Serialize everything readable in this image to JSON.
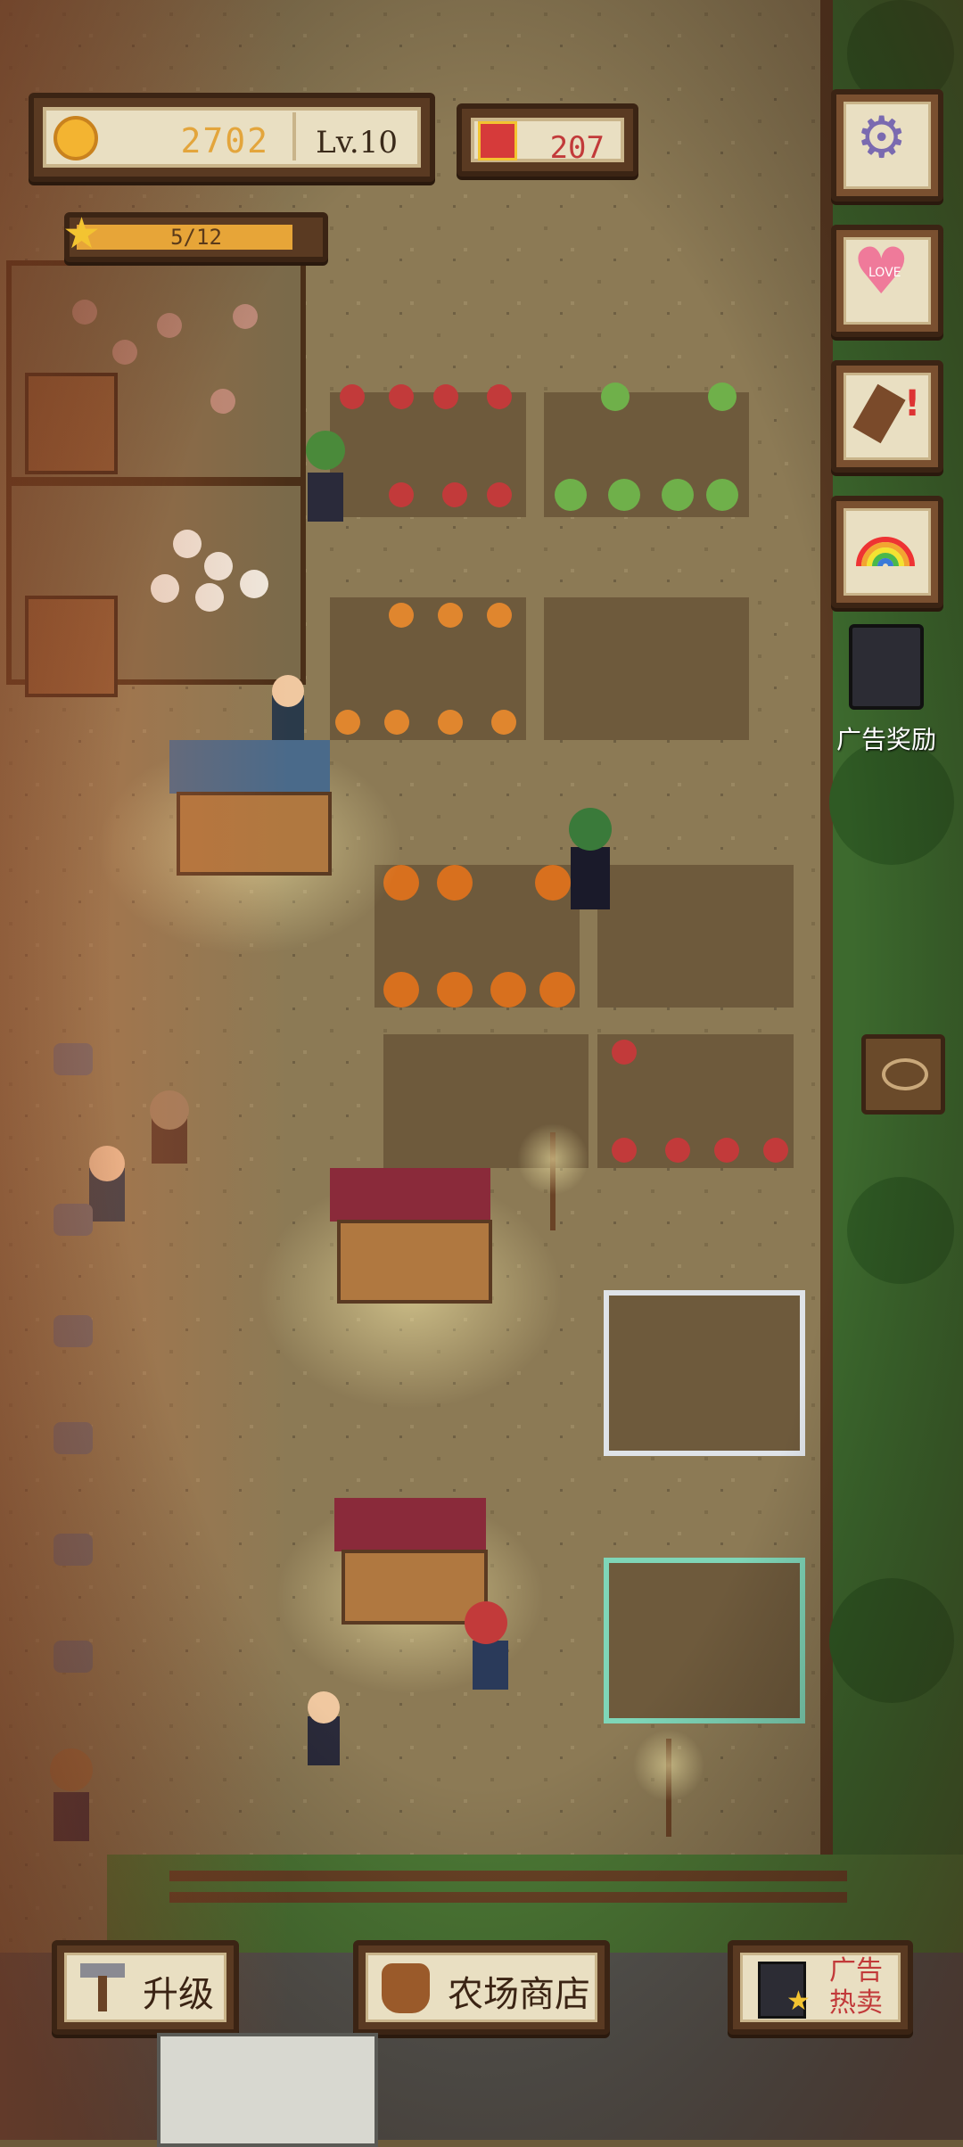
{
  "hud": {
    "coins": "2702",
    "level": "Lv.10",
    "gifts": "207",
    "xp_progress": "5/12",
    "xp_fraction": 0.4167
  },
  "side_buttons": [
    {
      "name": "settings",
      "icon": "gear-icon"
    },
    {
      "name": "love",
      "icon": "heart-icon",
      "label": "LOVE"
    },
    {
      "name": "hint",
      "icon": "shovel-icon"
    },
    {
      "name": "rainbow",
      "icon": "rainbow-icon"
    }
  ],
  "ad_reward": {
    "label": "广告奖励",
    "icon": "tv-icon"
  },
  "bottom_bar": {
    "upgrade": "升级",
    "shop": "农场商店",
    "ad_sale_line1": "广告",
    "ad_sale_line2": "热卖"
  },
  "colors": {
    "coin": "#e3a53c",
    "gift": "#c23a3a",
    "panel": "#e9dfc2",
    "frame": "#3b2414",
    "dirt": "#8b7550",
    "grass": "#3d6a2e"
  }
}
